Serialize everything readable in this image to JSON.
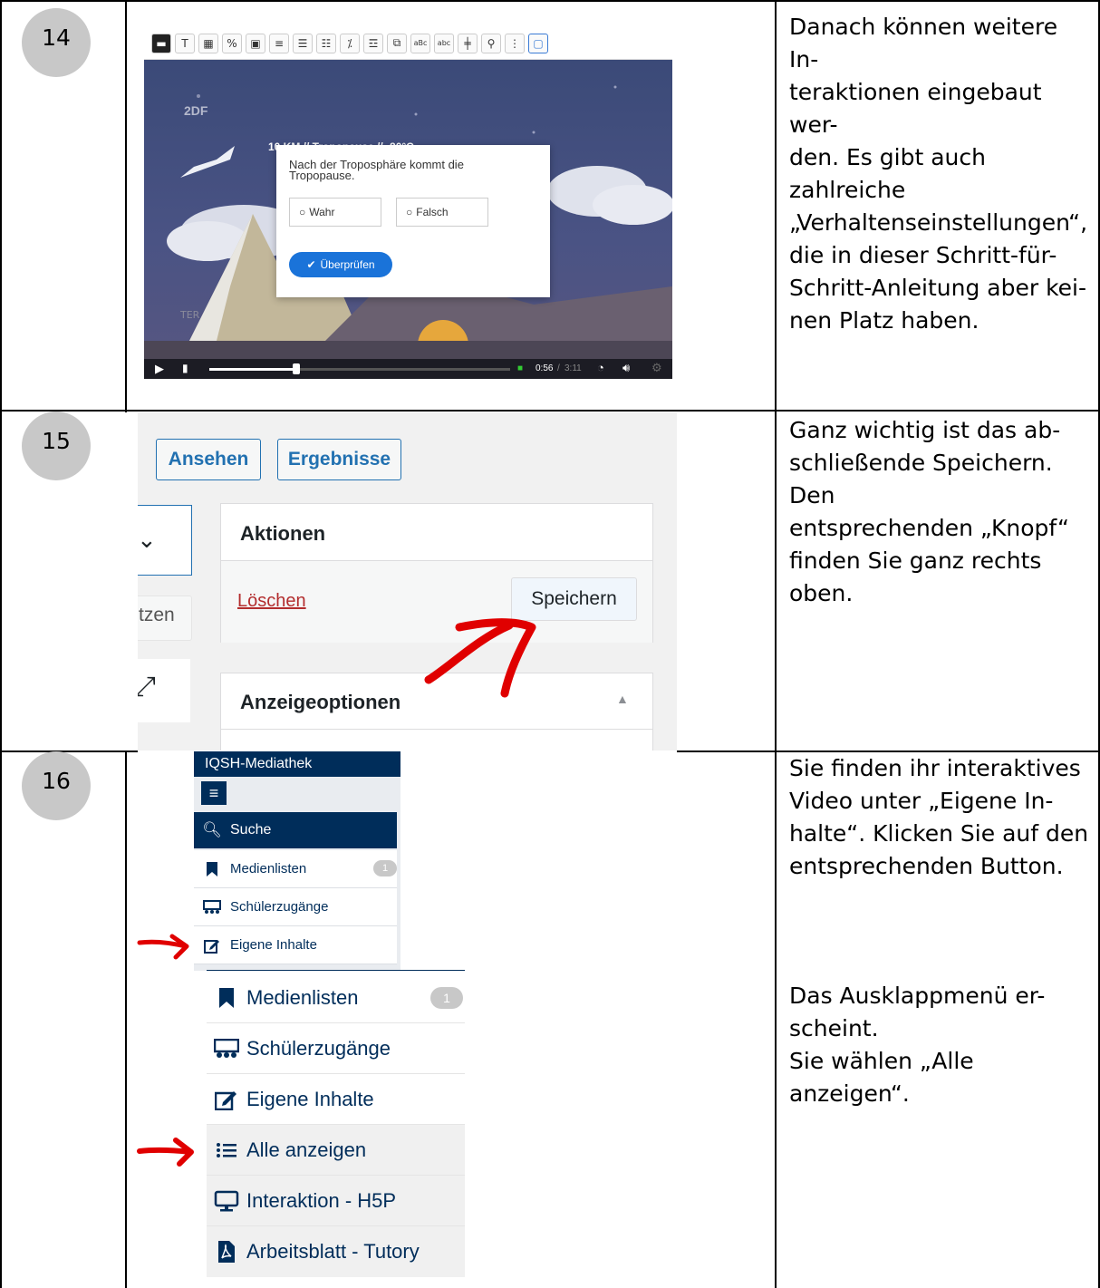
{
  "steps": [
    {
      "number": "14",
      "description": "Danach können weitere In-\nteraktionen eingebaut wer-\nden. Es gibt auch zahlreiche\n„Verhaltenseinstellungen“,\ndie in dieser Schritt-für-\nSchritt-Anleitung aber kei-\nnen Platz haben."
    },
    {
      "number": "15",
      "description": "Ganz wichtig ist das ab-\nschließende Speichern. Den\nentsprechenden „Knopf“\nfinden Sie ganz rechts\noben."
    },
    {
      "number": "16",
      "description": "Sie finden ihr interaktives\nVideo unter „Eigene In-\nhalte“. Klicken Sie auf den\nentsprechenden Button.",
      "description2": "Das Ausklappmenü er-\nscheint.\nSie wählen „Alle anzeigen“."
    }
  ],
  "video": {
    "channel_logo": "2DF",
    "altitude_label": "10 KM // Tropopause // -80°C",
    "question": "Nach der Troposphäre kommt die Tropopause.",
    "option_true": "Wahr",
    "option_false": "Falsch",
    "check_button": "Überprüfen",
    "time_current": "0:56",
    "time_total": "3:11",
    "progress": 0.29,
    "watermark": "TER"
  },
  "admin": {
    "view_button": "Ansehen",
    "results_button": "Ergebnisse",
    "actions_title": "Aktionen",
    "delete_link": "Löschen",
    "save_button": "Speichern",
    "display_options_title": "Anzeigeoptionen",
    "partial_text": "tzen"
  },
  "mediathek": {
    "title": "IQSH-Mediathek",
    "search": "Suche",
    "sidebar_items": [
      {
        "label": "Medienlisten",
        "badge": "1",
        "icon": "bookmark-icon"
      },
      {
        "label": "Schülerzugänge",
        "icon": "classroom-icon"
      },
      {
        "label": "Eigene Inhalte",
        "icon": "edit-icon"
      }
    ],
    "dropdown_items": [
      {
        "label": "Medienlisten",
        "badge": "1",
        "icon": "bookmark-icon"
      },
      {
        "label": "Schülerzugänge",
        "icon": "classroom-icon"
      },
      {
        "label": "Eigene Inhalte",
        "icon": "edit-icon"
      },
      {
        "label": "Alle anzeigen",
        "icon": "list-icon"
      },
      {
        "label": "Interaktion - H5P",
        "icon": "monitor-icon"
      },
      {
        "label": "Arbeitsblatt - Tutory",
        "icon": "pdf-icon"
      }
    ]
  },
  "colors": {
    "step_circle": "#c8c8c8",
    "wp_blue": "#2271b1",
    "mediathek_navy": "#002d5a",
    "annotation_red": "#e00000"
  }
}
